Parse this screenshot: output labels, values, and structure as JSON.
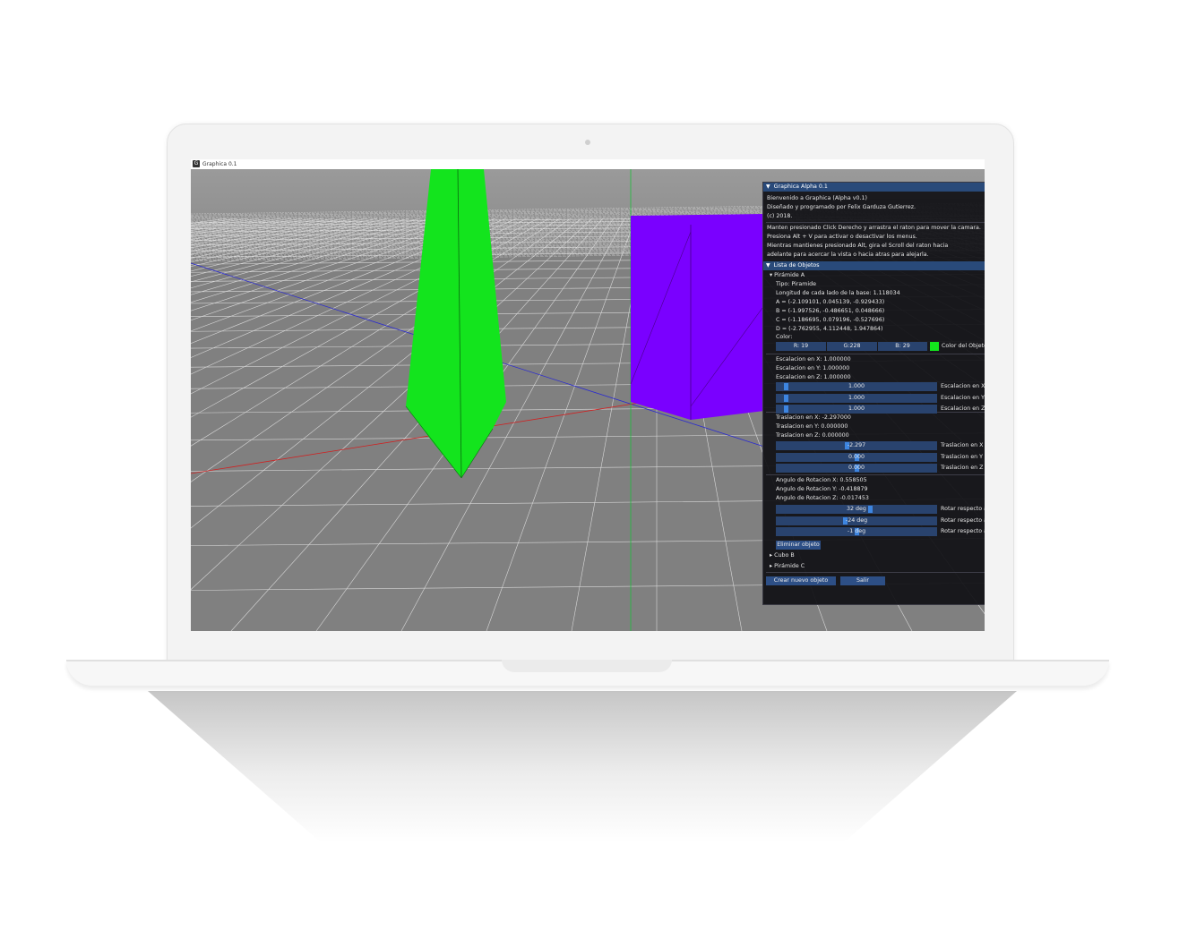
{
  "app": {
    "title": "Graphica 0.1",
    "icon_letter": "G"
  },
  "panel": {
    "header": "Graphica Alpha 0.1",
    "intro": [
      "Bienvenido a Graphica (Alpha v0.1)",
      "Diseñado y programado por Felix Garduza Gutierrez.",
      "(c) 2018."
    ],
    "help": [
      "Manten presionado Click Derecho y arrastra el raton para mover la camara.",
      "Presiona Alt + V para activar o desactivar los menus.",
      "Mientras mantienes presionado Alt, gira el Scroll del raton hacia",
      "adelante para acercar la vista o hacia atras para alejarla."
    ],
    "objects_header": "Lista de Objetos",
    "selected": {
      "name": "Pirámide A",
      "type": "Tipo: Piramide",
      "base_length": "Longitud de cada lado de la base:   1.118034",
      "vertices": [
        "A = (-2.109101, 0.045139, -0.929433)",
        "B = (-1.997526, -0.486651, 0.048666)",
        "C = (-1.186695, 0.079196, -0.527696)",
        "D = (-2.762955, 4.112448, 1.947864)"
      ],
      "color_label": "Color:",
      "color": {
        "r": "R: 19",
        "g": "G:228",
        "b": "B: 29",
        "label": "Color del Objeto",
        "hex": "#13e41d"
      },
      "scale_text": [
        "Escalacion en X:  1.000000",
        "Escalacion en Y:  1.000000",
        "Escalacion en Z:  1.000000"
      ],
      "scale_sliders": [
        {
          "value": "1.000",
          "label": "Escalacion en X",
          "level": 0.05
        },
        {
          "value": "1.000",
          "label": "Escalacion en Y",
          "level": 0.05
        },
        {
          "value": "1.000",
          "label": "Escalacion en Z",
          "level": 0.05
        }
      ],
      "translate_text": [
        "Traslacion en X:  -2.297000",
        "Traslacion en Y:  0.000000",
        "Traslacion en Z:  0.000000"
      ],
      "translate_sliders": [
        {
          "value": "-2.297",
          "label": "Traslacion en X",
          "level": 0.44
        },
        {
          "value": "0.000",
          "label": "Traslacion en Y",
          "level": 0.5
        },
        {
          "value": "0.000",
          "label": "Traslacion en Z",
          "level": 0.5
        }
      ],
      "rotation_text": [
        "Angulo de Rotacion X:  0.558505",
        "Angulo de Rotacion Y:  -0.418879",
        "Angulo de Rotacion Z:  -0.017453"
      ],
      "rotation_sliders": [
        {
          "value": "32 deg",
          "label": "Rotar respecto a",
          "level": 0.59
        },
        {
          "value": "-24 deg",
          "label": "Rotar respecto a",
          "level": 0.43
        },
        {
          "value": "-1 deg",
          "label": "Rotar respecto a",
          "level": 0.5
        }
      ],
      "delete_label": "Eliminar objeto"
    },
    "collapsed_items": [
      "Cubo B",
      "Pirámide C"
    ],
    "create_label": "Crear nuevo objeto",
    "exit_label": "Salir"
  },
  "colors": {
    "pyramid": "#13e41d",
    "cube": "#7a00ff",
    "floor": "#808080",
    "panel_header": "#294a7a"
  }
}
